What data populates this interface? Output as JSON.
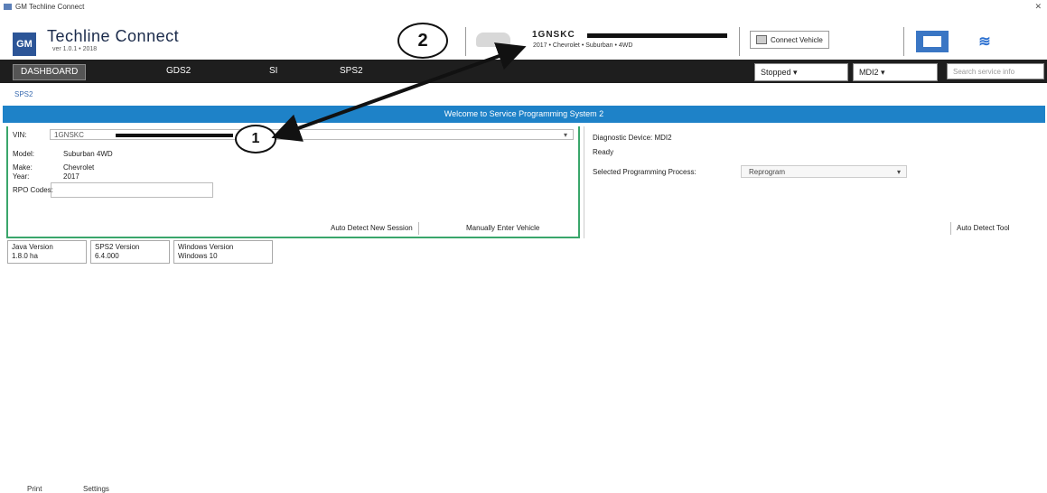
{
  "window": {
    "title": "GM Techline Connect"
  },
  "header": {
    "app_title": "Techline Connect",
    "version": "ver 1.0.1 • 2018",
    "step2_label": "2",
    "vehicle_vin": "1GNSKC",
    "vehicle_sub": "2017 • Chevrolet • Suburban • 4WD",
    "connect_label": "Connect Vehicle"
  },
  "nav": {
    "tabs": [
      "DASHBOARD",
      "GDS2",
      "SI",
      "SPS2"
    ],
    "stopped_label": "Stopped",
    "mdi_label": "MDI2",
    "search_placeholder": "Search service info"
  },
  "breadcrumb": "SPS2",
  "banner_text": "Welcome to Service Programming System 2",
  "left_panel": {
    "step1_label": "1",
    "vin_label": "VIN:",
    "vin_value": "1GNSKC",
    "rows": [
      {
        "label": "Model:",
        "value": "Suburban 4WD"
      },
      {
        "label": "Make:",
        "value": "Chevrolet"
      },
      {
        "label": "Year:",
        "value": "2017"
      }
    ],
    "rpo_label": "RPO Codes:",
    "btn_auto_detect": "Auto Detect New Session",
    "btn_manual": "Manually Enter Vehicle"
  },
  "right_panel": {
    "diag_label": "Diagnostic Device: MDI2",
    "status_label": "Ready",
    "process_label": "Selected Programming Process:",
    "process_value": "Reprogram",
    "btn_auto_detect_tool": "Auto Detect Tool"
  },
  "versions": [
    {
      "title": "Java Version",
      "value": "1.8.0 ha"
    },
    {
      "title": "SPS2 Version",
      "value": "6.4.000"
    },
    {
      "title": "Windows Version",
      "value": "Windows 10"
    }
  ],
  "bottom": {
    "left": "Print",
    "right": "Settings"
  }
}
